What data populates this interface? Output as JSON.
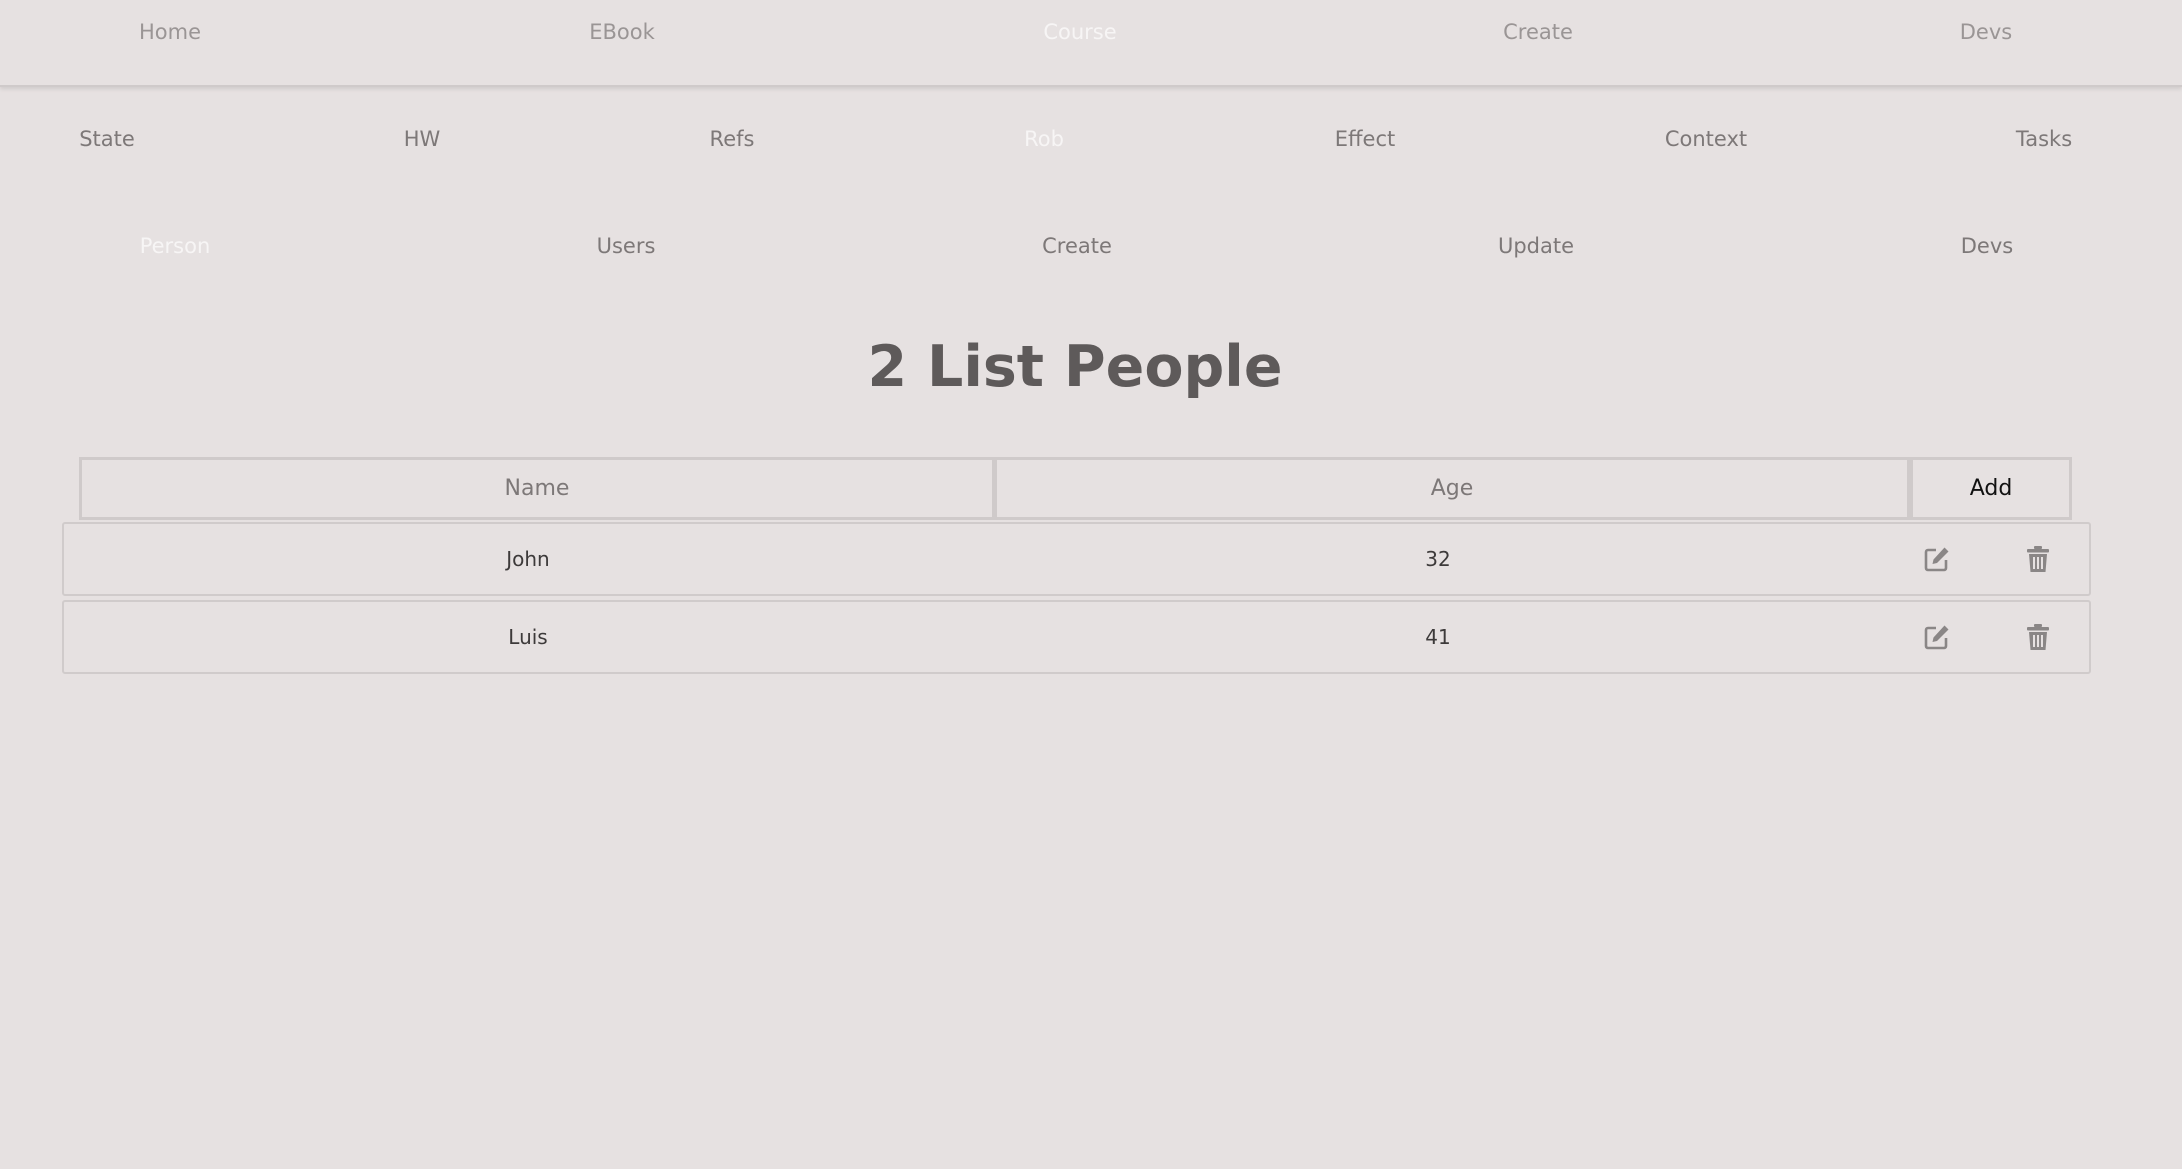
{
  "topnav": {
    "items": [
      {
        "label": "Home"
      },
      {
        "label": "EBook"
      },
      {
        "label": "Course"
      },
      {
        "label": "Create"
      },
      {
        "label": "Devs"
      }
    ]
  },
  "subnav1": {
    "items": [
      {
        "label": "State"
      },
      {
        "label": "HW"
      },
      {
        "label": "Refs"
      },
      {
        "label": "Rob"
      },
      {
        "label": "Effect"
      },
      {
        "label": "Context"
      },
      {
        "label": "Tasks"
      }
    ]
  },
  "subnav2": {
    "items": [
      {
        "label": "Person"
      },
      {
        "label": "Users"
      },
      {
        "label": "Create"
      },
      {
        "label": "Update"
      },
      {
        "label": "Devs"
      }
    ]
  },
  "page": {
    "title": "2 List People"
  },
  "form": {
    "name_placeholder": "Name",
    "age_placeholder": "Age",
    "add_label": "Add"
  },
  "people": [
    {
      "name": "John",
      "age": "32"
    },
    {
      "name": "Luis",
      "age": "41"
    }
  ],
  "icons": {
    "edit": "edit-icon",
    "delete": "trash-icon"
  },
  "colors": {
    "background": "#e6e1e1",
    "active_link": "#f7f5f5",
    "link": "#8d8888",
    "title": "#5e5a5a",
    "icon": "#8a8686"
  }
}
